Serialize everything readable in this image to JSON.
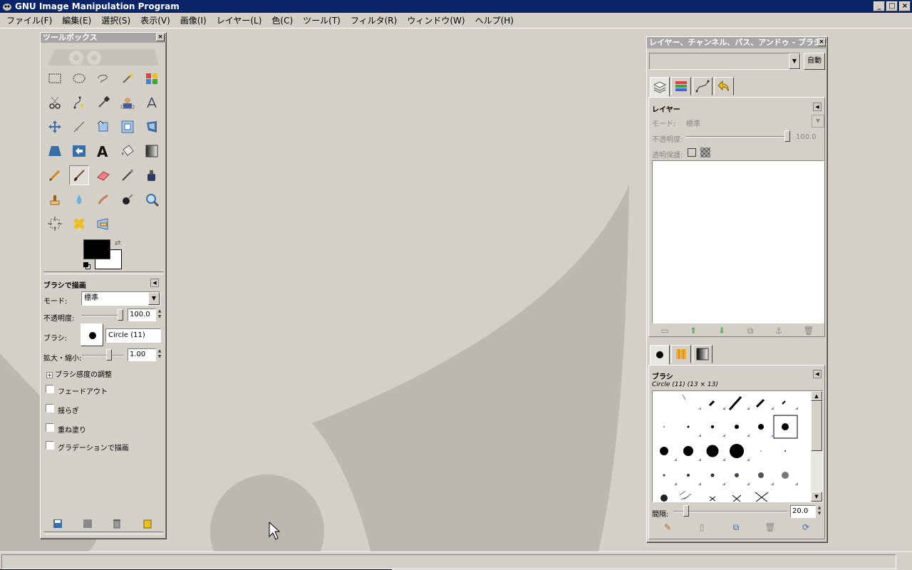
{
  "window": {
    "title": "GNU Image Manipulation Program",
    "buttons": {
      "minimize": "_",
      "maximize": "□",
      "close": "×"
    }
  },
  "menubar": {
    "items": [
      "ファイル(F)",
      "編集(E)",
      "選択(S)",
      "表示(V)",
      "画像(I)",
      "レイヤー(L)",
      "色(C)",
      "ツール(T)",
      "フィルタ(R)",
      "ウィンドウ(W)",
      "ヘルプ(H)"
    ]
  },
  "toolbox": {
    "title": "ツールボックス",
    "tools": [
      "rect-select",
      "ellipse-select",
      "free-select",
      "fuzzy-select",
      "select-by-color",
      "scissors",
      "paths",
      "color-picker",
      "foreground-select",
      "measure",
      "move",
      "align",
      "crop",
      "rotate",
      "scale",
      "shear",
      "perspective",
      "flip",
      "text",
      "bucket-fill",
      "blend",
      "pencil",
      "paintbrush",
      "eraser",
      "airbrush",
      "ink",
      "clone",
      "heal",
      "smudge",
      "dodge-burn",
      "zoom",
      "transform-cage",
      "heal-bandaid",
      "perspective-clone"
    ],
    "selected_tool": "paintbrush",
    "fg_color": "#000000",
    "bg_color": "#ffffff"
  },
  "tool_options": {
    "title": "ブラシで描画",
    "mode_label": "モード:",
    "mode_value": "標準",
    "opacity_label": "不透明度:",
    "opacity_value": "100.0",
    "brush_label": "ブラシ:",
    "brush_value": "Circle (11)",
    "scale_label": "拡大・縮小:",
    "scale_value": "1.00",
    "pressure_label": "ブラシ感度の調整",
    "fadeout_label": "フェードアウト",
    "jitter_label": "揺らぎ",
    "incremental_label": "重ね塗り",
    "gradient_label": "グラデーションで描画"
  },
  "dock": {
    "title": "レイヤー、チャンネル、パス、アンドゥ - ブラシ...",
    "auto_button": "自動",
    "layers": {
      "title": "レイヤー",
      "mode_label": "モード:",
      "mode_value": "標準",
      "opacity_label": "不透明度:",
      "opacity_value": "100.0",
      "lock_label": "透明保護:"
    },
    "brushes": {
      "title": "ブラシ",
      "current": "Circle (11) (13 × 13)",
      "spacing_label": "間隔:",
      "spacing_value": "20.0"
    }
  }
}
